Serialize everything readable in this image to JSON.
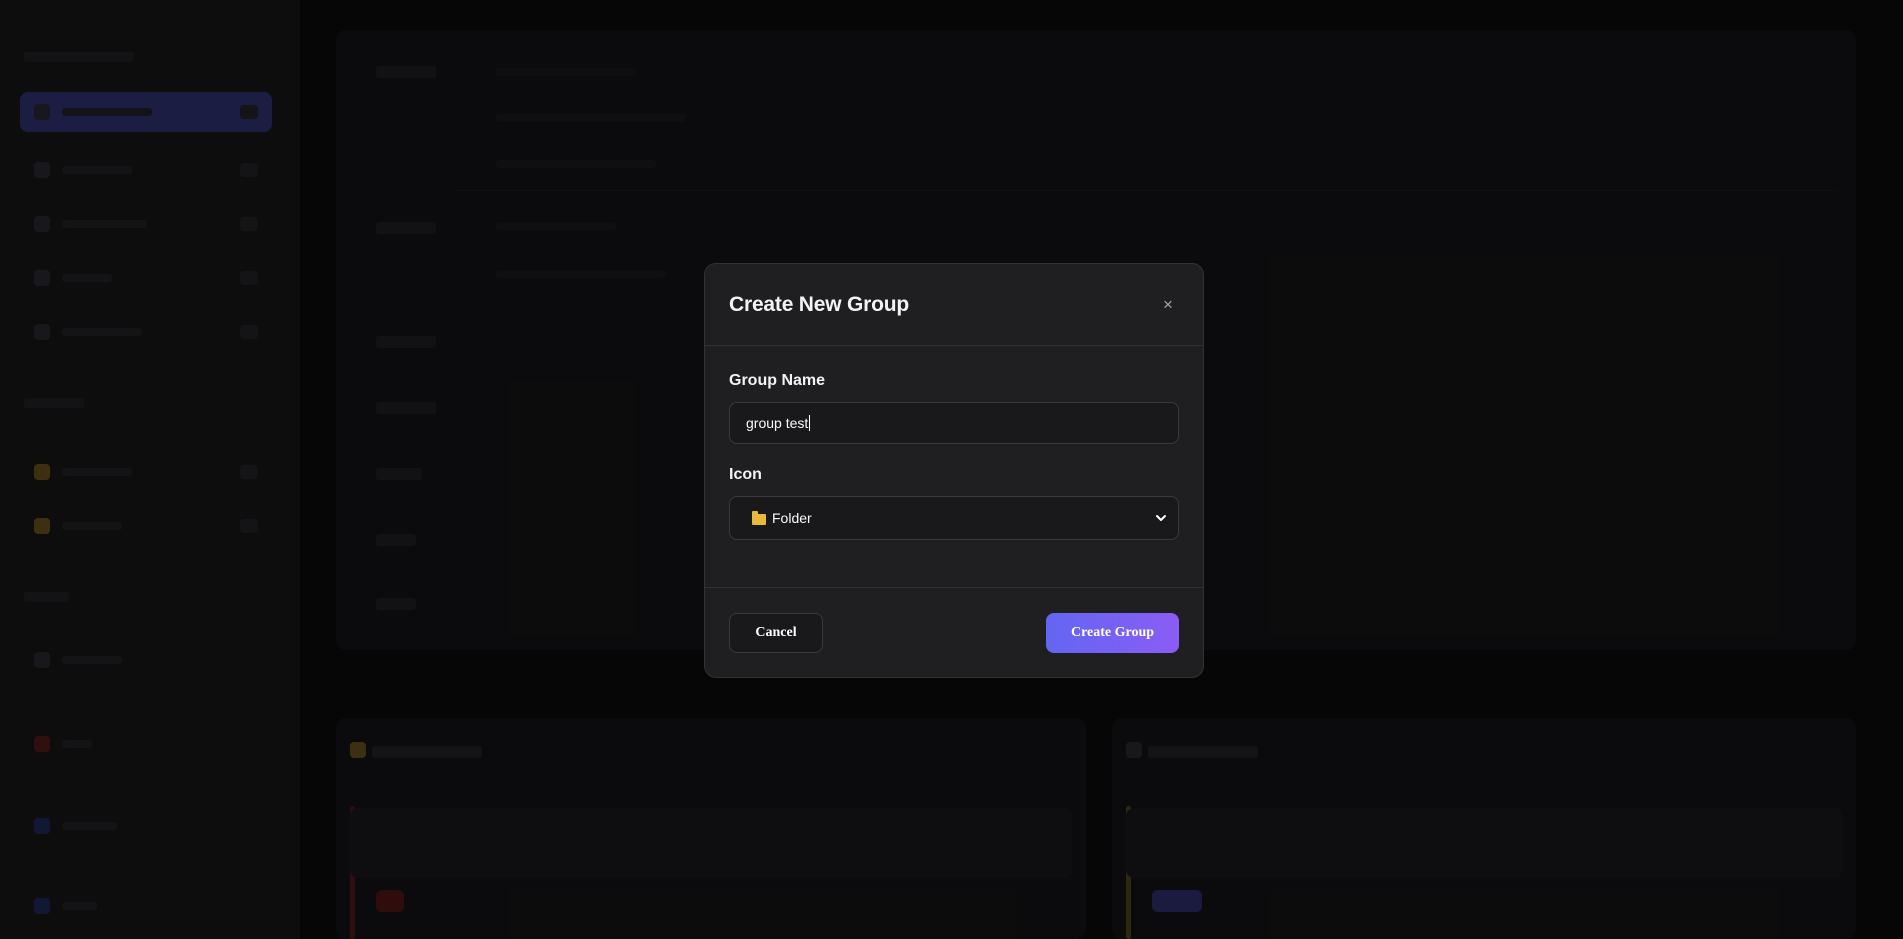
{
  "modal": {
    "title": "Create New Group",
    "close_glyph": "×",
    "group_name_label": "Group Name",
    "group_name_value": "group test",
    "icon_label": "Icon",
    "icon_selected": "Folder",
    "icon_selected_icon": "folder-icon",
    "cancel_label": "Cancel",
    "create_label": "Create Group"
  },
  "colors": {
    "accent_start": "#6366f1",
    "accent_end": "#8b5cf6",
    "modal_bg": "#1f1f21",
    "page_bg": "#0a0a0b"
  }
}
